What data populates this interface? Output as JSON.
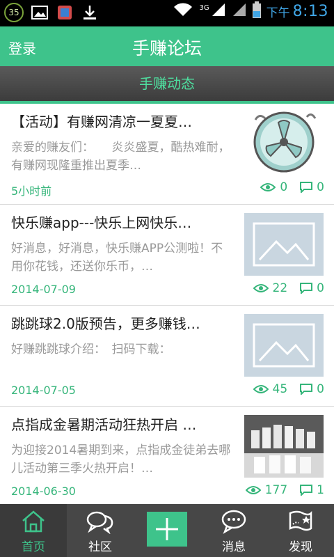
{
  "status_bar": {
    "badge": "35",
    "ampm": "下午",
    "time": "8:13",
    "network": "3G"
  },
  "header": {
    "login_label": "登录",
    "title": "手赚论坛"
  },
  "section": {
    "title": "手赚动态"
  },
  "posts": [
    {
      "title": "【活动】有赚网清凉一夏夏…",
      "desc": "亲爱的赚友们：　　炎炎盛夏，酷热难耐，有赚网现隆重推出夏季…",
      "date": "5小时前",
      "views": "0",
      "comments": "0",
      "thumb": "fan"
    },
    {
      "title": "快乐赚app---快乐上网快乐…",
      "desc": "好消息，好消息，快乐赚APP公测啦！不用你花钱，还送你乐币，…",
      "date": "2014-07-09",
      "views": "22",
      "comments": "0",
      "thumb": "placeholder"
    },
    {
      "title": "跳跳球2.0版预告，更多赚钱…",
      "desc": "好赚跳跳球介绍：　扫码下载：",
      "date": "2014-07-05",
      "views": "45",
      "comments": "0",
      "thumb": "placeholder"
    },
    {
      "title": "点指成金暑期活动狂热开启 …",
      "desc": "为迎接2014暑期到来，点指成金徒弟去哪儿活动第三季火热开启！…",
      "date": "2014-06-30",
      "views": "177",
      "comments": "1",
      "thumb": "photo"
    }
  ],
  "tabs": [
    {
      "label": "首页",
      "icon": "home-icon"
    },
    {
      "label": "社区",
      "icon": "chat-bubbles-icon"
    },
    {
      "label": "",
      "icon": "plus-icon"
    },
    {
      "label": "消息",
      "icon": "message-icon"
    },
    {
      "label": "发现",
      "icon": "map-flag-icon"
    }
  ],
  "colors": {
    "accent": "#3ec38b",
    "section_text": "#4fe0a0",
    "status_time": "#40a6e6",
    "tabbar": "#474747"
  }
}
